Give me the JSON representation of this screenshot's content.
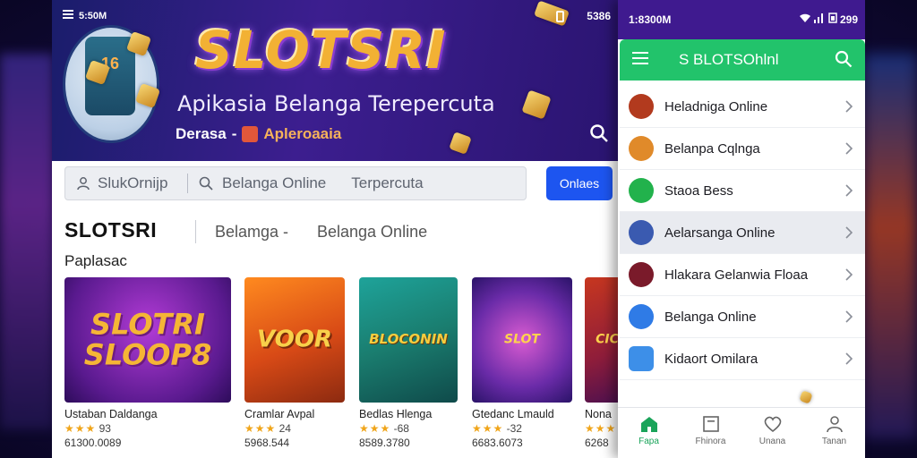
{
  "colors": {
    "accent_blue": "#1d55f0",
    "app_bar_green": "#22c36b",
    "phone_status_purple": "#3f1a8f",
    "rating_star": "#f0a51a"
  },
  "main": {
    "status": {
      "menu_icon": "menu-icon",
      "time": "5:50M",
      "battery_text": "5386"
    },
    "hero": {
      "logo_text": "SLOTSRI",
      "subtitle": "Apikasia Belanga Terepercuta",
      "tag_prefix": "Derasa",
      "tag_dash": "-",
      "tag_brand": "Apleroaaia"
    },
    "search": {
      "field_label": "SlukOrnijp",
      "query": "Belanga Online",
      "query_sub": "Terpercuta",
      "button_label": "Onlaes"
    },
    "section": {
      "title": "SLOTSRI",
      "crumb1": "Belamga -",
      "crumb2": "Belanga Online",
      "subtitle": "Paplasac"
    },
    "cards": [
      {
        "art": "SLOTRI SLOOP8",
        "name": "Ustaban Daldanga",
        "rating_stars": "★★★",
        "rating_value": "93",
        "count": "61300.0089"
      },
      {
        "art": "VOOR",
        "name": "Cramlar Avpal",
        "rating_stars": "★★★",
        "rating_value": "24",
        "count": "5968.544"
      },
      {
        "art": "BLOCONIN",
        "name": "Bedlas Hlenga",
        "rating_stars": "★★★",
        "rating_value": "-68",
        "count": "8589.3780"
      },
      {
        "art": "SLOT",
        "name": "Gtedanc Lmauld",
        "rating_stars": "★★★",
        "rating_value": "-32",
        "count": "6683.6073"
      },
      {
        "art": "CIC",
        "name": "Nona",
        "rating_stars": "★★★",
        "rating_value": "",
        "count": "6268"
      }
    ]
  },
  "phone": {
    "status": {
      "time": "1:8300M",
      "icons_text": "299"
    },
    "app_bar_title": "S BLOTSOhlnl",
    "menu": [
      {
        "label": "Heladniga Online",
        "icon": "storefront-icon",
        "icon_color": "#b23a1e"
      },
      {
        "label": "Belanpa Cqlnga",
        "icon": "person-avatar-icon",
        "icon_color": "#e08a2a"
      },
      {
        "label": "Staoa Bess",
        "icon": "chat-bubble-icon",
        "icon_color": "#22b24c"
      },
      {
        "label": "Aelarsanga Online",
        "icon": "slot-machine-icon",
        "icon_color": "#3a5ab0"
      },
      {
        "label": "Hlakara Gelanwia Floaa",
        "icon": "game-badge-icon",
        "icon_color": "#7a1a2a"
      },
      {
        "label": "Belanga Online",
        "icon": "shopping-bag-icon",
        "icon_color": "#2f7be6"
      },
      {
        "label": "Kidaort Omilara",
        "icon": "calculator-icon",
        "icon_color": "#3d8fe8"
      }
    ],
    "active_menu_index": 3,
    "bottom_nav": [
      {
        "label": "Fapa",
        "icon": "home-icon",
        "active": true
      },
      {
        "label": "Fhinora",
        "icon": "document-icon",
        "active": false
      },
      {
        "label": "Unana",
        "icon": "heart-icon",
        "active": false
      },
      {
        "label": "Tanan",
        "icon": "profile-icon",
        "active": false
      }
    ]
  }
}
